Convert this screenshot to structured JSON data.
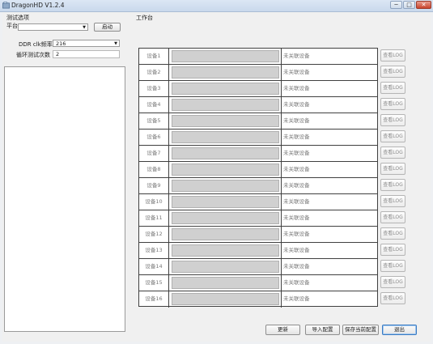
{
  "window": {
    "title": "DragonHD V1.2.4",
    "min_symbol": "─",
    "max_symbol": "□",
    "close_symbol": "✕"
  },
  "left": {
    "section_title": "测试选项",
    "platform_label": "平台",
    "platform_value": "",
    "start_button": "启动",
    "ddr_label": "DDR clk频率",
    "ddr_value": "216",
    "loop_label": "循环测试次数",
    "loop_value": "2"
  },
  "workbench": {
    "title": "工作台",
    "devices": [
      {
        "name": "设备1",
        "status": "未关联设备",
        "progress": 0,
        "log": "查看LOG"
      },
      {
        "name": "设备2",
        "status": "未关联设备",
        "progress": 0,
        "log": "查看LOG"
      },
      {
        "name": "设备3",
        "status": "未关联设备",
        "progress": 0,
        "log": "查看LOG"
      },
      {
        "name": "设备4",
        "status": "未关联设备",
        "progress": 0,
        "log": "查看LOG"
      },
      {
        "name": "设备5",
        "status": "未关联设备",
        "progress": 0,
        "log": "查看LOG"
      },
      {
        "name": "设备6",
        "status": "未关联设备",
        "progress": 0,
        "log": "查看LOG"
      },
      {
        "name": "设备7",
        "status": "未关联设备",
        "progress": 0,
        "log": "查看LOG"
      },
      {
        "name": "设备8",
        "status": "未关联设备",
        "progress": 0,
        "log": "查看LOG"
      },
      {
        "name": "设备9",
        "status": "未关联设备",
        "progress": 0,
        "log": "查看LOG"
      },
      {
        "name": "设备10",
        "status": "未关联设备",
        "progress": 0,
        "log": "查看LOG"
      },
      {
        "name": "设备11",
        "status": "未关联设备",
        "progress": 0,
        "log": "查看LOG"
      },
      {
        "name": "设备12",
        "status": "未关联设备",
        "progress": 0,
        "log": "查看LOG"
      },
      {
        "name": "设备13",
        "status": "未关联设备",
        "progress": 0,
        "log": "查看LOG"
      },
      {
        "name": "设备14",
        "status": "未关联设备",
        "progress": 0,
        "log": "查看LOG"
      },
      {
        "name": "设备15",
        "status": "未关联设备",
        "progress": 0,
        "log": "查看LOG"
      },
      {
        "name": "设备16",
        "status": "未关联设备",
        "progress": 0,
        "log": "查看LOG"
      }
    ]
  },
  "footer": {
    "refresh": "更新",
    "import_config": "导入配置",
    "save_config": "保存当前配置",
    "exit": "退出"
  }
}
